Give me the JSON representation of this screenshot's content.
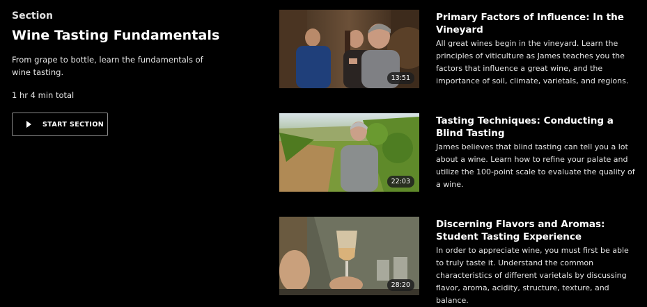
{
  "section": {
    "eyebrow": "Section",
    "title": "Wine Tasting Fundamentals",
    "description": "From grape to bottle, learn the fundamentals of wine tasting.",
    "total": "1 hr 4 min total",
    "start_label": "START SECTION",
    "start_icon": "play-icon"
  },
  "lessons": [
    {
      "title": "Primary Factors of Influence: In the Vineyard",
      "description": "All great wines begin in the vineyard. Learn the principles of viticulture as James teaches you the factors that influence a great wine, and the importance of soil, climate, varietals, and regions.",
      "duration": "13:51"
    },
    {
      "title": "Tasting Techniques: Conducting a Blind Tasting",
      "description": "James believes that blind tasting can tell you a lot about a wine. Learn how to refine your palate and utilize the 100-point scale to evaluate the quality of a wine.",
      "duration": "22:03"
    },
    {
      "title": "Discerning Flavors and Aromas: Student Tasting Experience",
      "description": "In order to appreciate wine, you must first be able to truly taste it. Understand the common characteristics of different varietals by discussing flavor, aroma, acidity, structure, texture, and balance.",
      "duration": "28:20"
    }
  ],
  "colors": {
    "background": "#000000",
    "text": "#ffffff",
    "button_border": "#8a8a8a",
    "duration_badge": "#1e1e1e"
  }
}
